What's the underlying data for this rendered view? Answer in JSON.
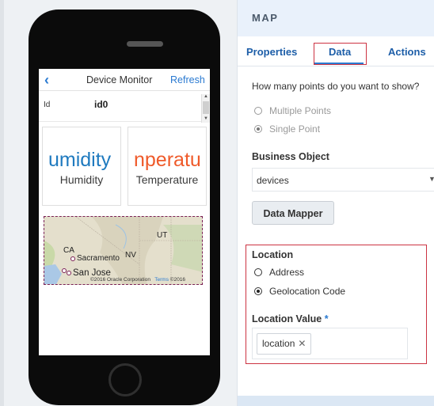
{
  "device": {
    "header": {
      "back_icon": "chevron-left-icon",
      "back_glyph": "‹",
      "title": "Device Monitor",
      "refresh_label": "Refresh"
    },
    "id_field": {
      "label": "Id",
      "value": "id0"
    },
    "tiles": [
      {
        "big_text": "umidity",
        "label": "Humidity"
      },
      {
        "big_text": "nperatu",
        "label": "Temperature"
      }
    ],
    "map": {
      "labels": [
        "CA",
        "Sacramento",
        "NV",
        "UT",
        "San Jose"
      ],
      "copyright": "©2016 Oracle Corporation",
      "terms": "Terms",
      "copyright2": "©2016"
    }
  },
  "panel": {
    "title": "MAP",
    "tabs": [
      "Properties",
      "Data",
      "Actions"
    ],
    "question": "How many points do you want to show?",
    "point_options": [
      {
        "label": "Multiple Points",
        "selected": false
      },
      {
        "label": "Single Point",
        "selected": true
      }
    ],
    "business_object": {
      "label": "Business Object",
      "value": "devices",
      "caret": "▼"
    },
    "data_mapper_button": "Data Mapper",
    "location": {
      "label": "Location",
      "options": [
        {
          "label": "Address",
          "selected": false
        },
        {
          "label": "Geolocation Code",
          "selected": true
        }
      ]
    },
    "location_value": {
      "label": "Location Value",
      "required_mark": "*",
      "chip": "location",
      "chip_remove": "✕"
    }
  },
  "colors": {
    "accent": "#2a7ad1",
    "highlight_border": "#cc3342",
    "humidity_text": "#1f7abf",
    "temperature_text": "#ef5a2a",
    "panel_header_bg": "#e9f1fb"
  }
}
